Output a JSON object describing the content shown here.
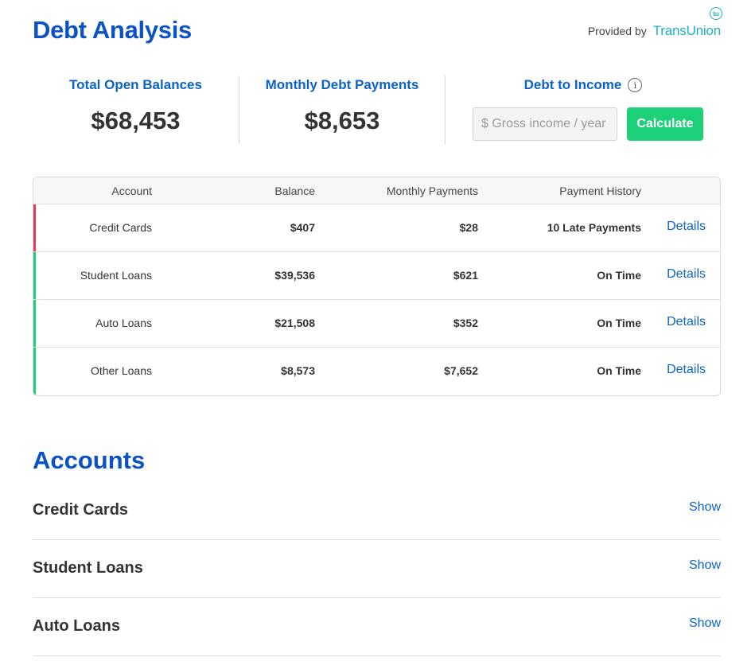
{
  "header": {
    "title": "Debt Analysis",
    "provided_by": "Provided by",
    "provider_name": "TransUnion",
    "provider_mark": "tu"
  },
  "summary": {
    "total_open_balances": {
      "label": "Total Open Balances",
      "value": "$68,453"
    },
    "monthly_debt_payments": {
      "label": "Monthly Debt Payments",
      "value": "$8,653"
    },
    "debt_to_income": {
      "label": "Debt to Income",
      "info_icon": "info-icon",
      "input_placeholder": "$ Gross income / year",
      "button_label": "Calculate"
    }
  },
  "table": {
    "columns": [
      "Account",
      "Balance",
      "Monthly Payments",
      "Payment History"
    ],
    "rows": [
      {
        "account": "Credit Cards",
        "balance": "$407",
        "monthly": "$28",
        "history": "10 Late Payments",
        "details": "Details",
        "status_color": "#e23c5a"
      },
      {
        "account": "Student Loans",
        "balance": "$39,536",
        "monthly": "$621",
        "history": "On Time",
        "details": "Details",
        "status_color": "#1ed07a"
      },
      {
        "account": "Auto Loans",
        "balance": "$21,508",
        "monthly": "$352",
        "history": "On Time",
        "details": "Details",
        "status_color": "#1ed07a"
      },
      {
        "account": "Other Loans",
        "balance": "$8,573",
        "monthly": "$7,652",
        "history": "On Time",
        "details": "Details",
        "status_color": "#1ed07a"
      }
    ]
  },
  "accounts": {
    "title": "Accounts",
    "items": [
      {
        "name": "Credit Cards",
        "action": "Show"
      },
      {
        "name": "Student Loans",
        "action": "Show"
      },
      {
        "name": "Auto Loans",
        "action": "Show"
      }
    ]
  },
  "colors": {
    "title_blue": "#0b52c4",
    "link_blue": "#0b63c9",
    "accent_green": "#1ed07a",
    "alert_red": "#e23c5a",
    "transunion_teal": "#1cb1c4"
  }
}
